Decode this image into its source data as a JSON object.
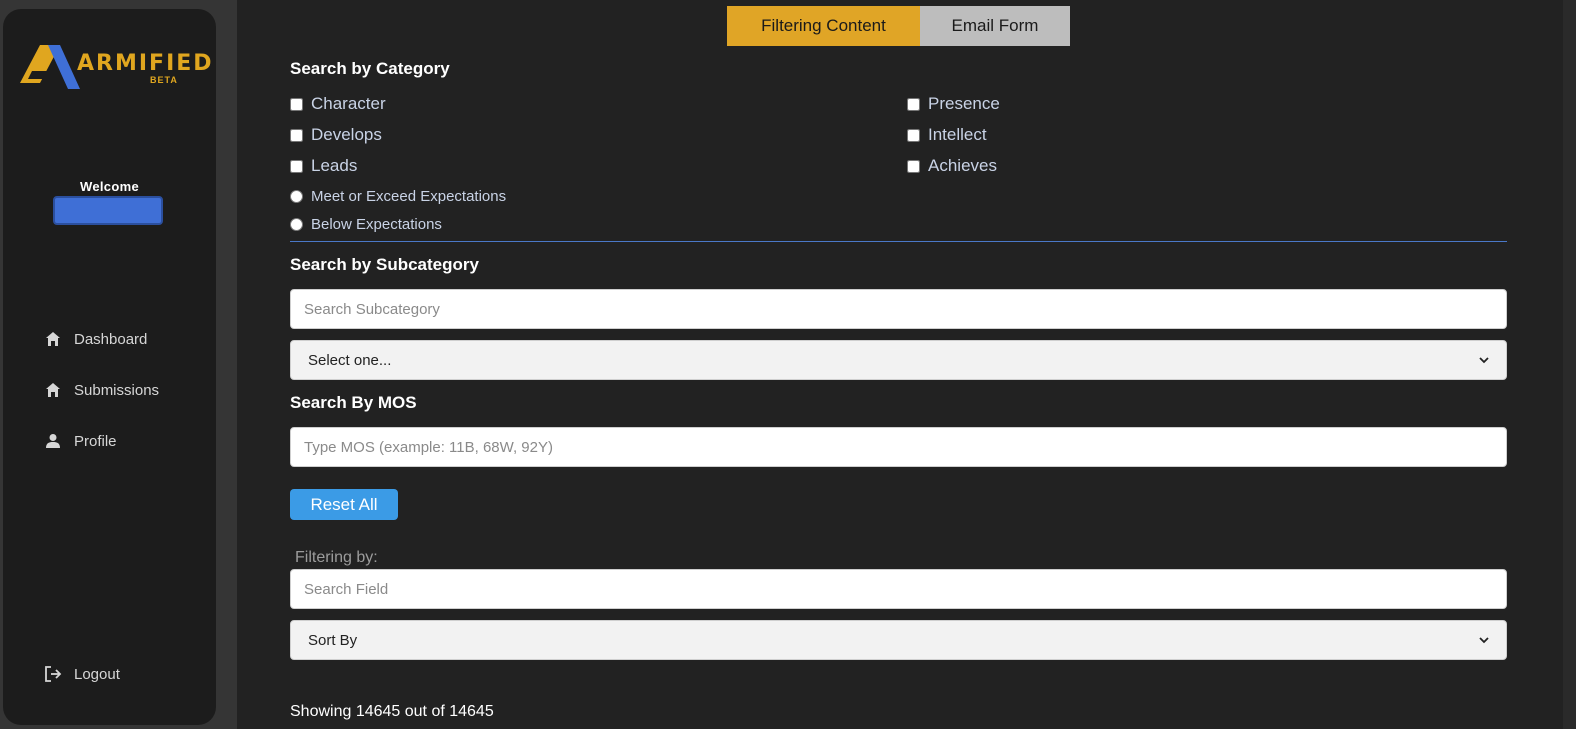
{
  "brand": {
    "name": "ARMIFIED",
    "badge": "BETA",
    "gold": "#e0a61f",
    "blue": "#3f6fd6"
  },
  "sidebar": {
    "welcome": "Welcome",
    "nav": [
      {
        "label": "Dashboard",
        "icon": "home-icon"
      },
      {
        "label": "Submissions",
        "icon": "home-icon"
      },
      {
        "label": "Profile",
        "icon": "user-icon"
      }
    ],
    "logout": {
      "label": "Logout",
      "icon": "logout-icon"
    }
  },
  "tabs": {
    "filtering": "Filtering Content",
    "email": "Email Form",
    "active_color": "#e0a526"
  },
  "category": {
    "title": "Search by Category",
    "left": [
      "Character",
      "Develops",
      "Leads"
    ],
    "right": [
      "Presence",
      "Intellect",
      "Achieves"
    ],
    "radios": [
      "Meet or Exceed Expectations",
      "Below Expectations"
    ]
  },
  "subcategory": {
    "title": "Search by Subcategory",
    "placeholder": "Search Subcategory",
    "select_value": "Select one..."
  },
  "mos": {
    "title": "Search By MOS",
    "placeholder": "Type MOS (example: 11B, 68W, 92Y)"
  },
  "reset_label": "Reset All",
  "filter": {
    "label": "Filtering by:",
    "placeholder": "Search Field",
    "sort_value": "Sort By"
  },
  "results": {
    "text": "Showing 14645 out of 14645"
  }
}
